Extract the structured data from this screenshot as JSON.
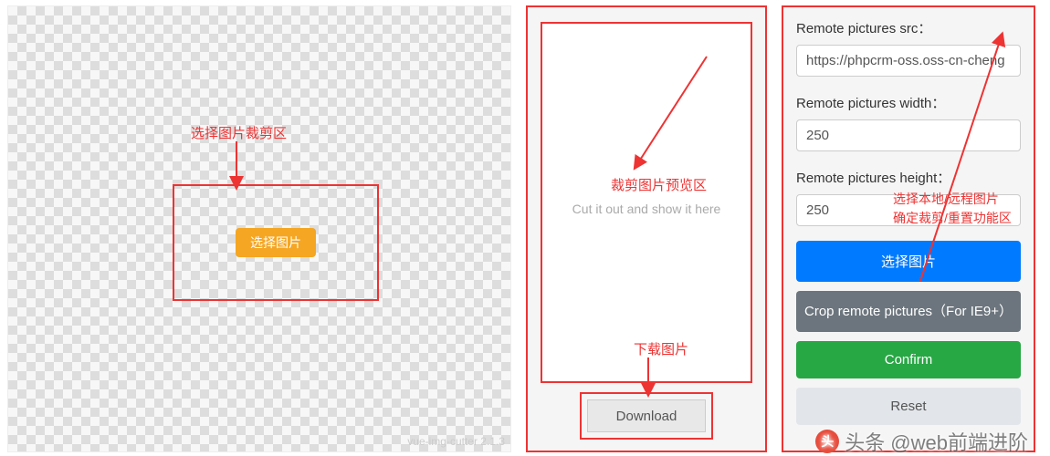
{
  "cutter": {
    "select_label": "选择图片",
    "version": "vue-img-cutter 2.1.3",
    "annotation": "选择图片裁剪区"
  },
  "preview": {
    "hint": "Cut it out and show it here",
    "download_label": "Download",
    "annotation_area": "裁剪图片预览区",
    "annotation_download": "下载图片"
  },
  "controls": {
    "src_label": "Remote pictures src：",
    "src_value": "https://phpcrm-oss.oss-cn-cheng",
    "width_label": "Remote pictures width：",
    "width_value": "250",
    "height_label": "Remote pictures height：",
    "height_value": "250",
    "select_btn": "选择图片",
    "crop_remote_btn": "Crop remote pictures（For IE9+）",
    "confirm_btn": "Confirm",
    "reset_btn": "Reset",
    "annotation_line1": "选择本地/远程图片",
    "annotation_line2": "确定裁剪/重置功能区"
  },
  "watermark": {
    "text": "头条 @web前端进阶"
  }
}
